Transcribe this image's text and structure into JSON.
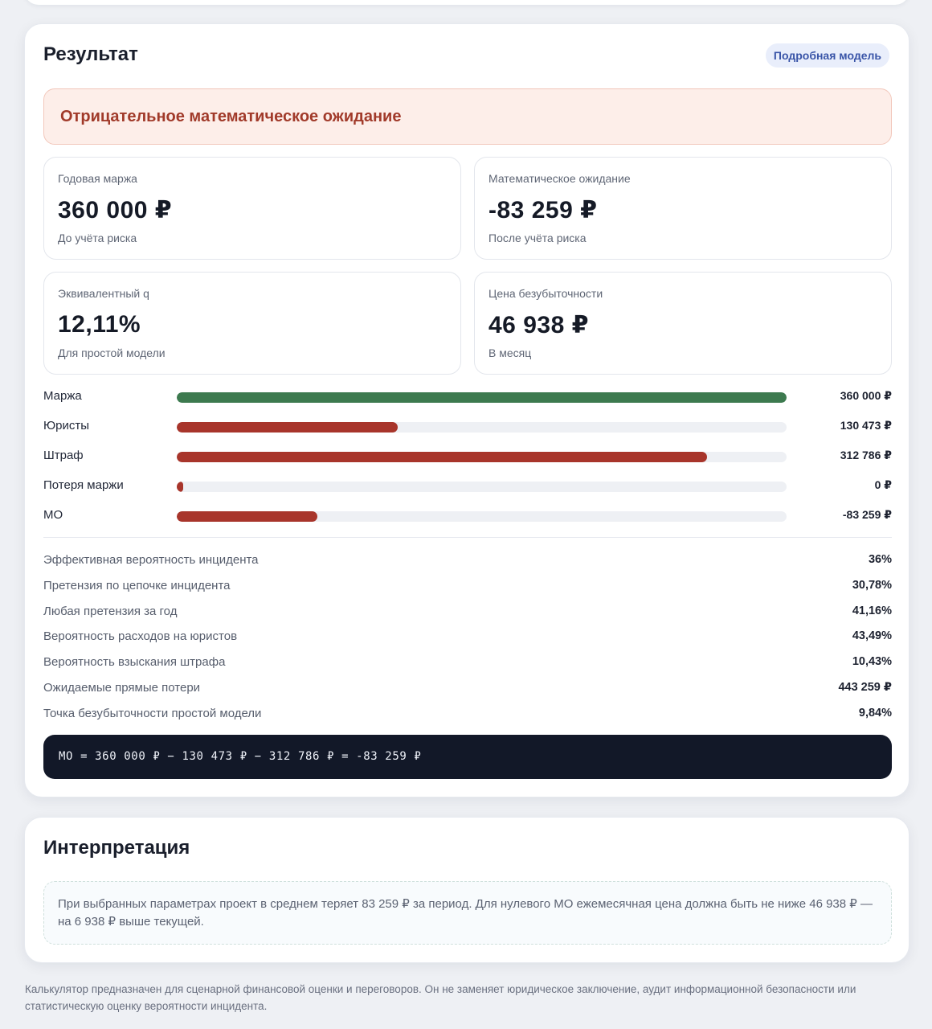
{
  "result": {
    "title": "Результат",
    "model_chip": "Подробная модель",
    "alert": "Отрицательное математическое ожидание",
    "metrics": [
      {
        "label": "Годовая маржа",
        "value": "360 000 ₽",
        "sub": "До учёта риска"
      },
      {
        "label": "Математическое ожидание",
        "value": "-83 259 ₽",
        "sub": "После учёта риска"
      },
      {
        "label": "Эквивалентный q",
        "value": "12,11%",
        "sub": "Для простой модели"
      },
      {
        "label": "Цена безубыточности",
        "value": "46 938 ₽",
        "sub": "В месяц"
      }
    ],
    "bars": [
      {
        "label": "Маржа",
        "value": "360 000 ₽",
        "fraction": 1.0,
        "color": "#3d7a4f"
      },
      {
        "label": "Юристы",
        "value": "130 473 ₽",
        "fraction": 0.362,
        "color": "#a8352b"
      },
      {
        "label": "Штраф",
        "value": "312 786 ₽",
        "fraction": 0.869,
        "color": "#a8352b"
      },
      {
        "label": "Потеря маржи",
        "value": "0 ₽",
        "fraction": 0.0,
        "color": "#a8352b"
      },
      {
        "label": "МО",
        "value": "-83 259 ₽",
        "fraction": 0.231,
        "color": "#a8352b"
      }
    ],
    "stats": [
      {
        "label": "Эффективная вероятность инцидента",
        "value": "36%"
      },
      {
        "label": "Претензия по цепочке инцидента",
        "value": "30,78%"
      },
      {
        "label": "Любая претензия за год",
        "value": "41,16%"
      },
      {
        "label": "Вероятность расходов на юристов",
        "value": "43,49%"
      },
      {
        "label": "Вероятность взыскания штрафа",
        "value": "10,43%"
      },
      {
        "label": "Ожидаемые прямые потери",
        "value": "443 259 ₽"
      },
      {
        "label": "Точка безубыточности простой модели",
        "value": "9,84%"
      }
    ],
    "formula": "МО = 360 000 ₽ − 130 473 ₽ − 312 786 ₽ = -83 259 ₽"
  },
  "interpretation": {
    "title": "Интерпретация",
    "text": "При выбранных параметрах проект в среднем теряет 83 259 ₽ за период. Для нулевого МО ежемесячная цена должна быть не ниже 46 938 ₽ — на 6 938 ₽ выше текущей."
  },
  "footer": "Калькулятор предназначен для сценарной финансовой оценки и переговоров. Он не заменяет юридическое заключение, аудит информационной безопасности или статистическую оценку вероятности инцидента."
}
